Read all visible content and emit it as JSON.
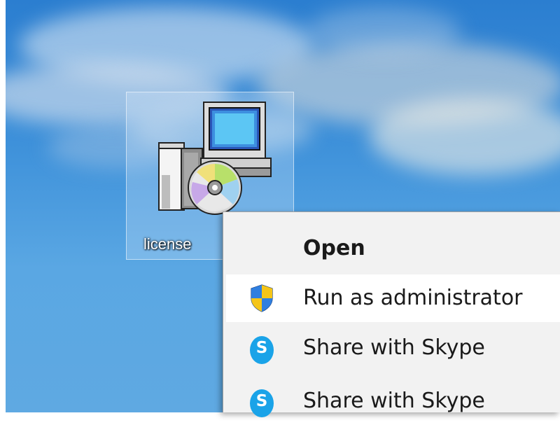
{
  "desktop": {
    "icon": {
      "name": "license",
      "icon": "installer-icon"
    }
  },
  "context_menu": {
    "items": [
      {
        "label": "Open",
        "bold": true,
        "icon": null
      },
      {
        "label": "Run as administrator",
        "icon": "uac-shield-icon",
        "highlighted": true
      },
      {
        "label": "Share with Skype",
        "icon": "skype-icon"
      },
      {
        "label": "Share with Skype",
        "icon": "skype-icon"
      }
    ]
  },
  "colors": {
    "menu_bg": "#f2f2f2",
    "menu_highlight": "#ffffff",
    "skype_blue": "#1aa3e8",
    "shield_blue": "#1f5fbf",
    "shield_yellow": "#f5c518"
  }
}
